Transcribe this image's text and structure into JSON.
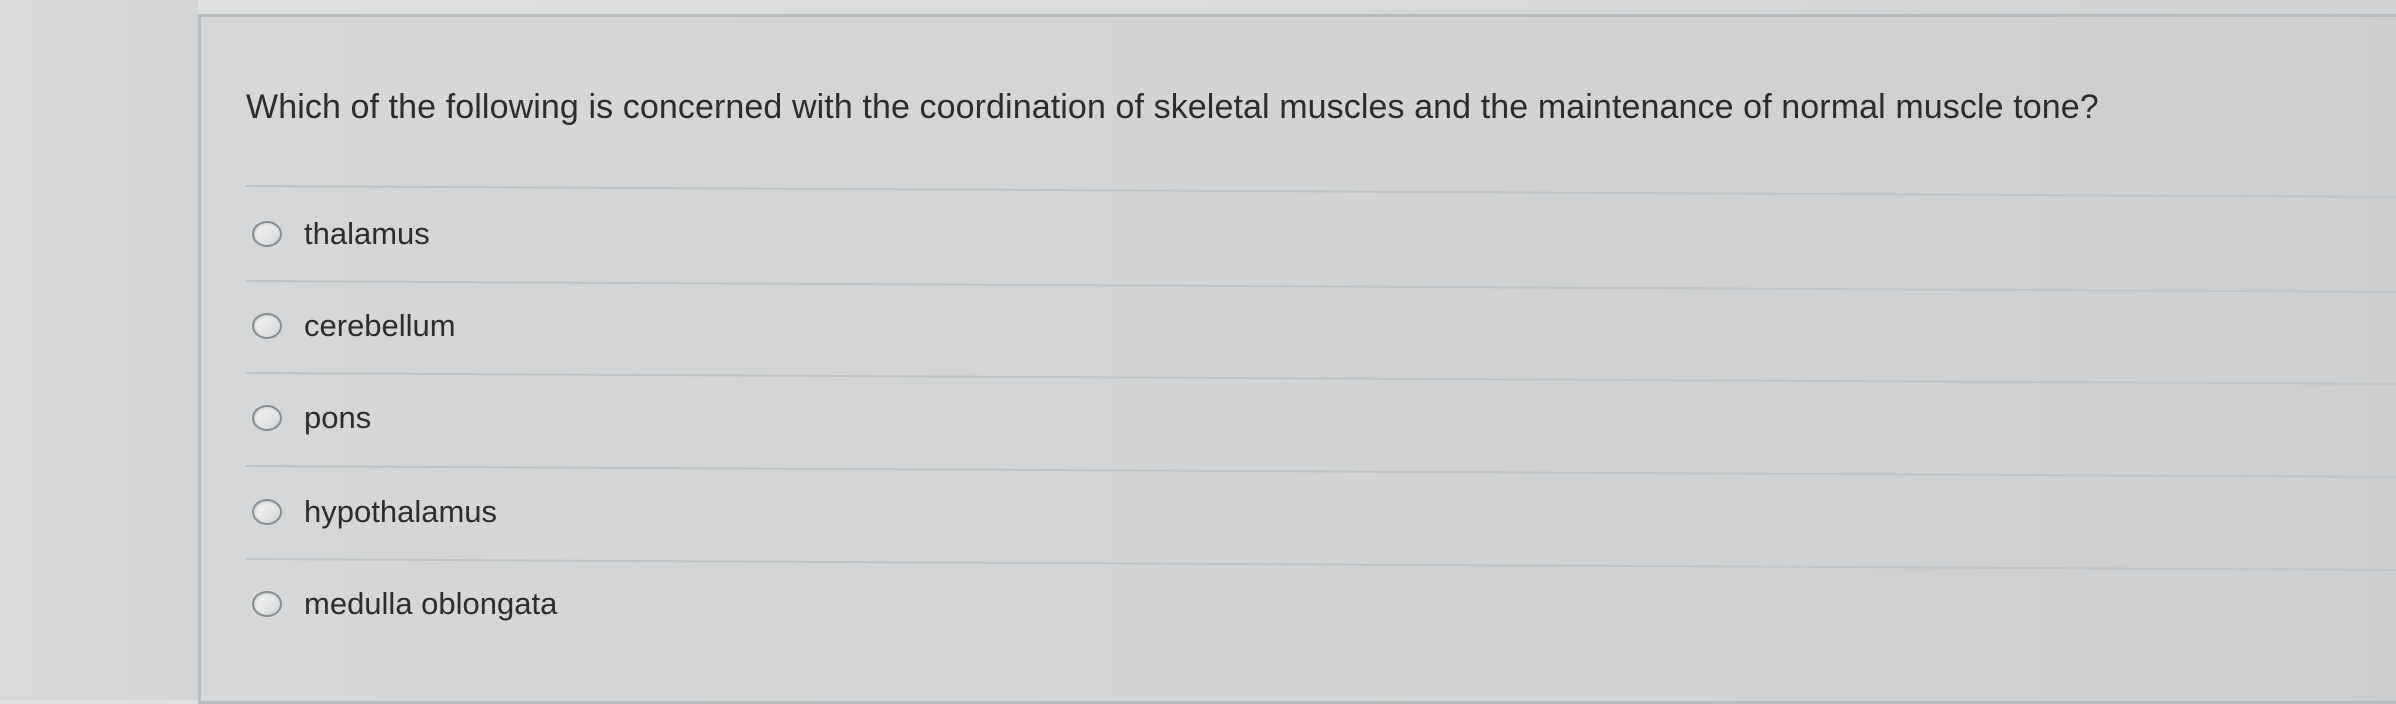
{
  "question": {
    "text": "Which of the following is concerned with the coordination of skeletal muscles and the maintenance of normal muscle tone?"
  },
  "options": [
    {
      "label": "thalamus",
      "selected": false
    },
    {
      "label": "cerebellum",
      "selected": false
    },
    {
      "label": "pons",
      "selected": false
    },
    {
      "label": "hypothalamus",
      "selected": false
    },
    {
      "label": "medulla oblongata",
      "selected": false
    }
  ]
}
